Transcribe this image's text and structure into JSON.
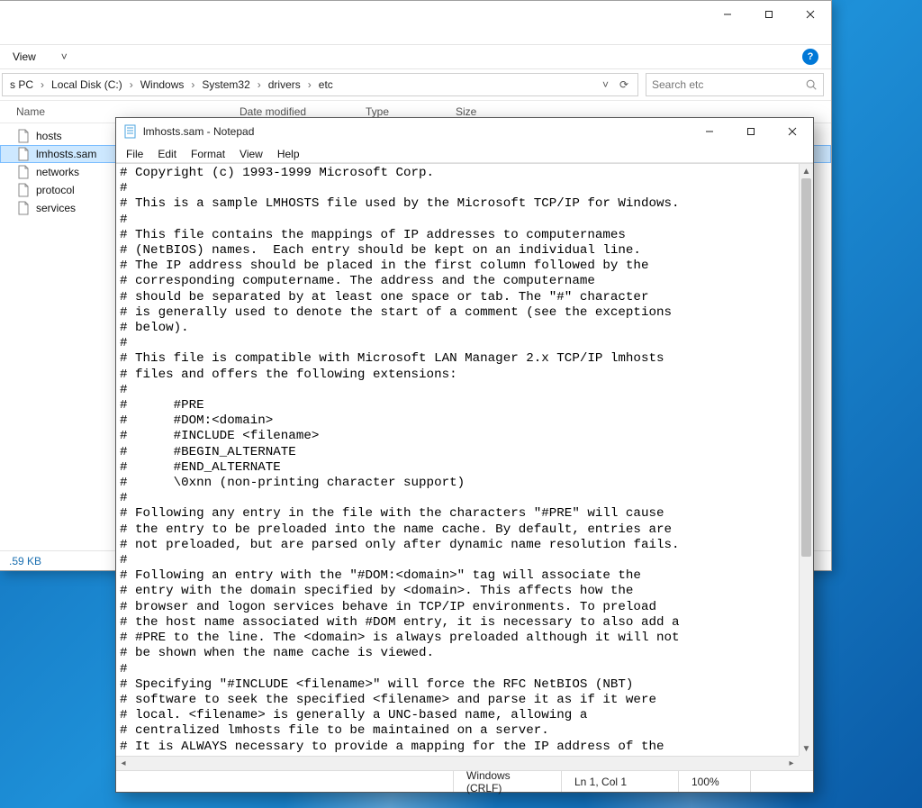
{
  "explorer": {
    "ribbon": {
      "view": "View"
    },
    "breadcrumb": [
      "s PC",
      "Local Disk (C:)",
      "Windows",
      "System32",
      "drivers",
      "etc"
    ],
    "search_placeholder": "Search etc",
    "columns": {
      "name": "Name",
      "date": "Date modified",
      "type": "Type",
      "size": "Size"
    },
    "files": [
      {
        "name": "hosts",
        "selected": false
      },
      {
        "name": "lmhosts.sam",
        "selected": true
      },
      {
        "name": "networks",
        "selected": false
      },
      {
        "name": "protocol",
        "selected": false
      },
      {
        "name": "services",
        "selected": false
      }
    ],
    "status": ".59 KB"
  },
  "notepad": {
    "title": "lmhosts.sam - Notepad",
    "menu": {
      "file": "File",
      "edit": "Edit",
      "format": "Format",
      "view": "View",
      "help": "Help"
    },
    "content": "# Copyright (c) 1993-1999 Microsoft Corp.\n#\n# This is a sample LMHOSTS file used by the Microsoft TCP/IP for Windows.\n#\n# This file contains the mappings of IP addresses to computernames\n# (NetBIOS) names.  Each entry should be kept on an individual line.\n# The IP address should be placed in the first column followed by the\n# corresponding computername. The address and the computername\n# should be separated by at least one space or tab. The \"#\" character\n# is generally used to denote the start of a comment (see the exceptions\n# below).\n#\n# This file is compatible with Microsoft LAN Manager 2.x TCP/IP lmhosts\n# files and offers the following extensions:\n#\n#      #PRE\n#      #DOM:<domain>\n#      #INCLUDE <filename>\n#      #BEGIN_ALTERNATE\n#      #END_ALTERNATE\n#      \\0xnn (non-printing character support)\n#\n# Following any entry in the file with the characters \"#PRE\" will cause\n# the entry to be preloaded into the name cache. By default, entries are\n# not preloaded, but are parsed only after dynamic name resolution fails.\n#\n# Following an entry with the \"#DOM:<domain>\" tag will associate the\n# entry with the domain specified by <domain>. This affects how the\n# browser and logon services behave in TCP/IP environments. To preload\n# the host name associated with #DOM entry, it is necessary to also add a\n# #PRE to the line. The <domain> is always preloaded although it will not\n# be shown when the name cache is viewed.\n#\n# Specifying \"#INCLUDE <filename>\" will force the RFC NetBIOS (NBT)\n# software to seek the specified <filename> and parse it as if it were\n# local. <filename> is generally a UNC-based name, allowing a\n# centralized lmhosts file to be maintained on a server.\n# It is ALWAYS necessary to provide a mapping for the IP address of the",
    "status": {
      "encoding": "Windows (CRLF)",
      "position": "Ln 1, Col 1",
      "zoom": "100%"
    }
  }
}
